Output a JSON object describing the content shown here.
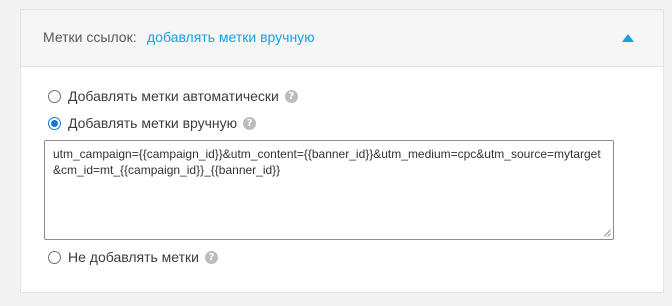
{
  "links_section": {
    "header": {
      "label": "Метки ссылок:",
      "value": "добавлять метки вручную",
      "toggle_icon": "chevron-up-icon"
    },
    "options": [
      {
        "label": "Добавлять метки автоматически",
        "checked": false,
        "help_icon": "question-icon"
      },
      {
        "label": "Добавлять метки вручную",
        "checked": true,
        "help_icon": "question-icon"
      },
      {
        "label": "Не добавлять метки",
        "checked": false,
        "help_icon": "question-icon"
      }
    ],
    "utm_template": "utm_campaign={{campaign_id}}&utm_content={{banner_id}}&utm_medium=cpc&utm_source=mytarget&cm_id=mt_{{campaign_id}}_{{banner_id}}"
  },
  "colors": {
    "accent": "#16a1e2",
    "radio_checked": "#1676d2",
    "background": "#f3f3f3",
    "header_background": "#f6f6f6"
  }
}
